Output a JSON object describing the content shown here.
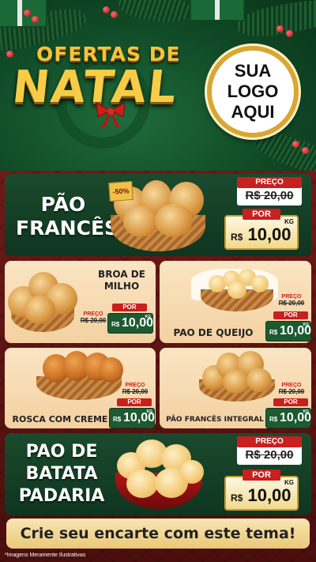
{
  "header": {
    "title_line1": "OFERTAS DE",
    "title_line2": "NATAL",
    "logo_text": [
      "SUA",
      "LOGO",
      "AQUI"
    ]
  },
  "products": [
    {
      "name_lines": [
        "PÃO",
        "FRANCÊS"
      ],
      "badge": "-50%",
      "preco_label": "PREÇO",
      "old_price": "R$ 20,00",
      "por_label": "POR",
      "currency": "R$",
      "price": "10,00",
      "unit": "KG"
    },
    {
      "name_lines": [
        "BROA DE",
        "MILHO"
      ],
      "preco_label": "PREÇO",
      "old_price": "R$ 20,00",
      "por_label": "POR",
      "currency": "R$",
      "price": "10,00",
      "unit": "KG"
    },
    {
      "name": "PAO DE QUEIJO",
      "preco_label": "PREÇO",
      "old_price": "R$ 20,00",
      "por_label": "POR",
      "currency": "R$",
      "price": "10,00",
      "unit": "KG"
    },
    {
      "name": "ROSCA COM CREME",
      "preco_label": "PREÇO",
      "old_price": "R$ 20,00",
      "por_label": "POR",
      "currency": "R$",
      "price": "10,00",
      "unit": "KG"
    },
    {
      "name": "PÃO FRANCÊS INTEGRAL",
      "preco_label": "PREÇO",
      "old_price": "R$ 20,00",
      "por_label": "POR",
      "currency": "R$",
      "price": "10,00",
      "unit": "KG"
    },
    {
      "name_lines": [
        "PAO DE",
        "BATATA",
        "PADARIA"
      ],
      "preco_label": "PREÇO",
      "old_price": "R$ 20,00",
      "por_label": "POR",
      "currency": "R$",
      "price": "10,00",
      "unit": "KG"
    }
  ],
  "cta": "Crie seu encarte com este tema!",
  "footnote": "*Imagens Meramente Ilustrativas",
  "colors": {
    "accent_red": "#c81f1f",
    "gold": "#f7cd47",
    "dark_green": "#1a4a2d",
    "cream": "#fbe5c3"
  },
  "icons": [
    "gift-box-icon",
    "holly-berry-icon",
    "red-bow-icon",
    "bread-basket-icon"
  ]
}
